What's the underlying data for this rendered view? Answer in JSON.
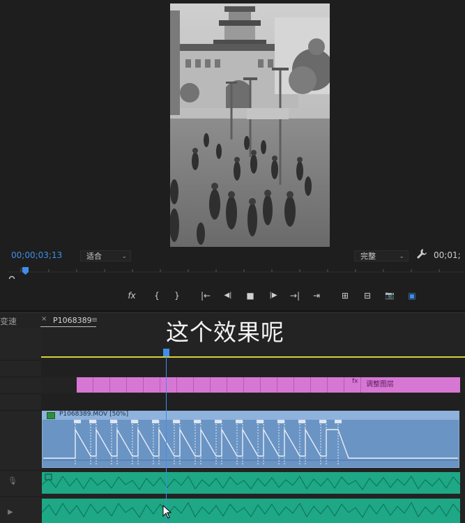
{
  "monitor": {
    "timecode_current": "00;00;03;13",
    "zoom_label": "适合",
    "quality_label": "完整",
    "timecode_end": "00;01;",
    "controls": [
      "fx",
      "{",
      "}",
      "|←",
      "◀|",
      "■",
      "|▶",
      "→|",
      "⇥",
      "⊞",
      "⊟",
      "📷",
      "▣"
    ]
  },
  "timeline": {
    "left_panel_label": "变速",
    "sequence_tab": "P1068389",
    "close_x": "×",
    "tab_menu": "≡",
    "adjustment_clip_label": "调整图层",
    "video_clip_label": "P1068389.MOV [50%]",
    "subtitle": "这个效果呢"
  },
  "colors": {
    "accent_blue": "#3f8fe8",
    "adjustment_pink": "#d777d4",
    "video_clip_blue": "#6a94c4",
    "audio_green": "#1ea885",
    "work_area_yellow": "#d9d23a"
  }
}
